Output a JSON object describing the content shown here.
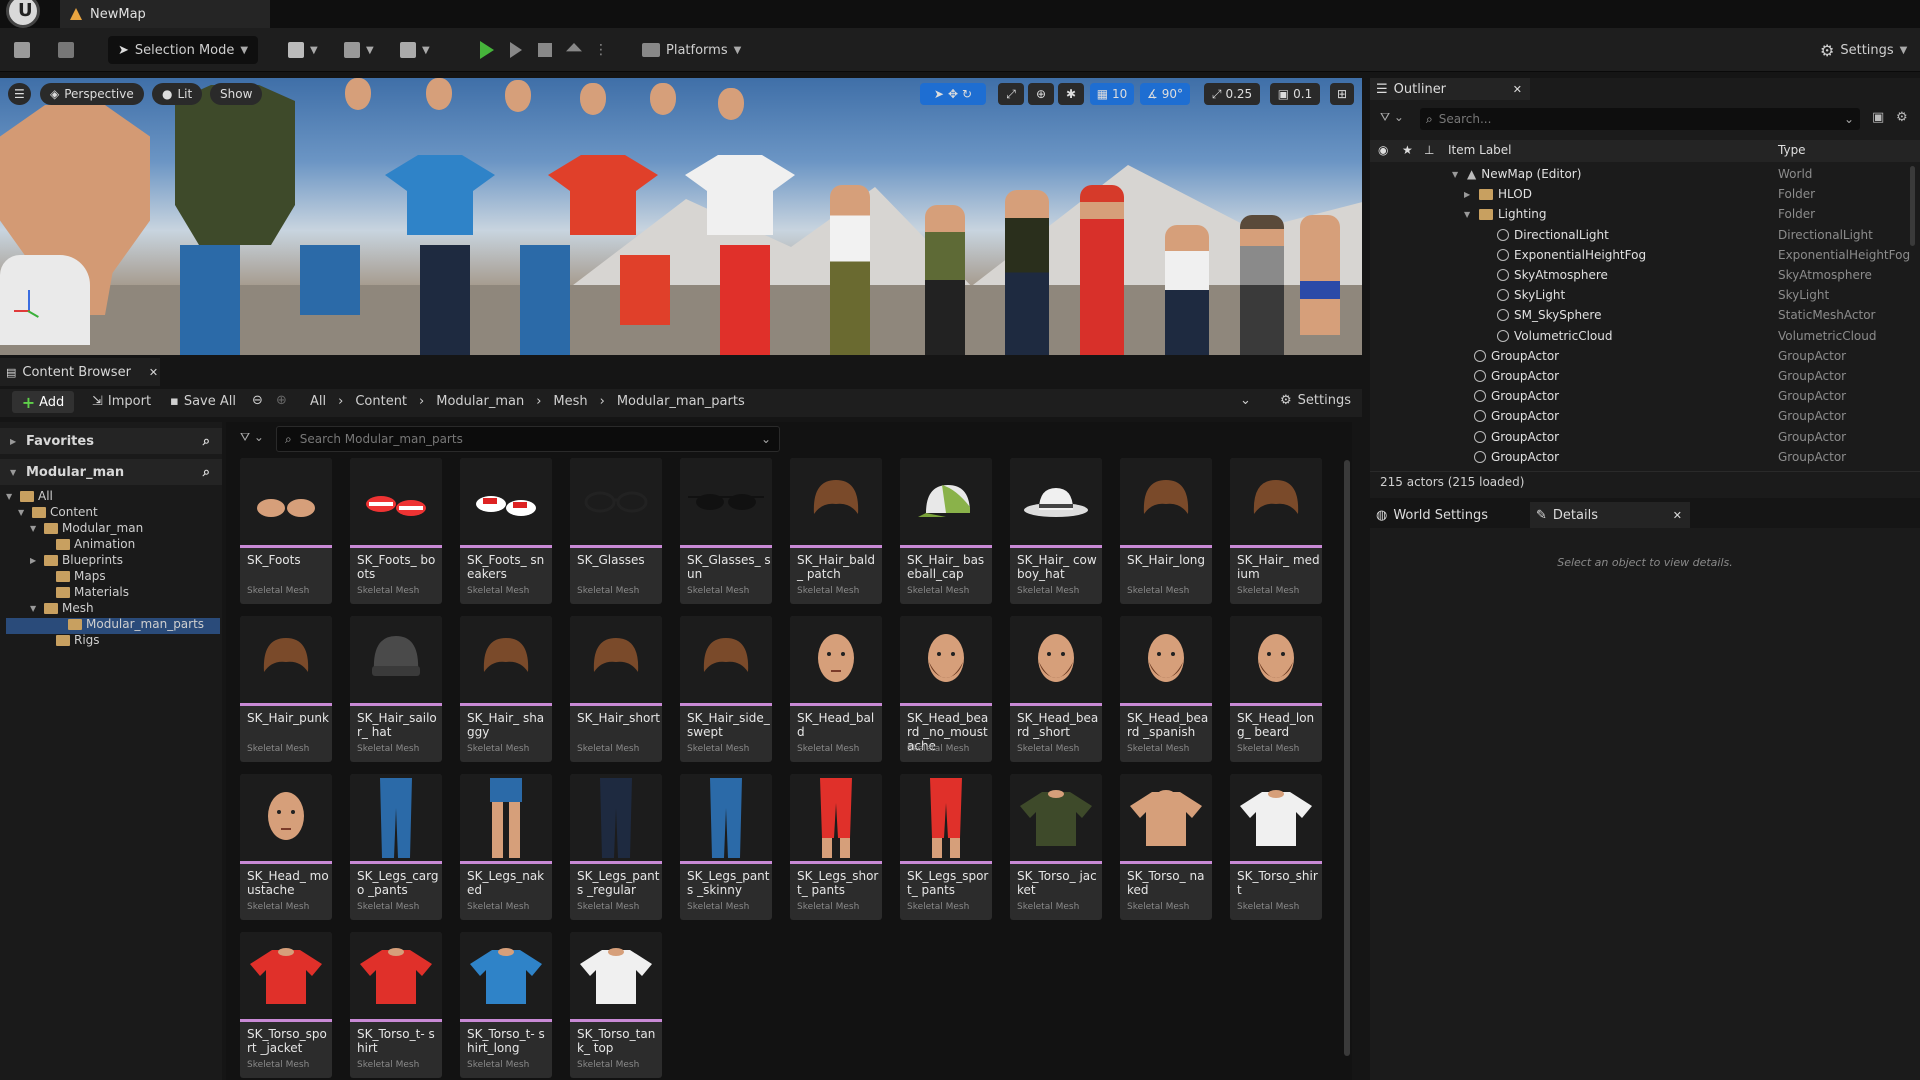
{
  "window": {
    "tab_title": "NewMap"
  },
  "toolbar": {
    "selection_mode": "Selection Mode",
    "platforms": "Platforms",
    "settings": "Settings"
  },
  "viewport": {
    "perspective": "Perspective",
    "lit": "Lit",
    "show": "Show",
    "grid_value": "10",
    "angle_value": "90°",
    "scale_value": "0.25",
    "camera_speed": "0.1"
  },
  "content_browser": {
    "tab_title": "Content Browser",
    "add": "Add",
    "import": "Import",
    "save_all": "Save All",
    "breadcrumb": [
      "All",
      "Content",
      "Modular_man",
      "Mesh",
      "Modular_man_parts"
    ],
    "settings": "Settings",
    "favorites": "Favorites",
    "root_name": "Modular_man",
    "search_placeholder": "Search Modular_man_parts",
    "tree": [
      "All",
      "Content",
      "Modular_man",
      "Animation",
      "Blueprints",
      "Maps",
      "Materials",
      "Mesh",
      "Modular_man_parts",
      "Rigs"
    ],
    "asset_type": "Skeletal Mesh",
    "assets": [
      {
        "name": "SK_Foots",
        "icon": "feet"
      },
      {
        "name": "SK_Foots_ boots",
        "icon": "boots"
      },
      {
        "name": "SK_Foots_ sneakers",
        "icon": "sneakers"
      },
      {
        "name": "SK_Glasses",
        "icon": "glasses"
      },
      {
        "name": "SK_Glasses_ sun",
        "icon": "sunglasses"
      },
      {
        "name": "SK_Hair_bald_ patch",
        "icon": "hair"
      },
      {
        "name": "SK_Hair_ baseball_cap",
        "icon": "cap"
      },
      {
        "name": "SK_Hair_ cowboy_hat",
        "icon": "hat"
      },
      {
        "name": "SK_Hair_long",
        "icon": "hair"
      },
      {
        "name": "SK_Hair_ medium",
        "icon": "hair"
      },
      {
        "name": "SK_Hair_punk",
        "icon": "hair"
      },
      {
        "name": "SK_Hair_sailor_ hat",
        "icon": "beanie"
      },
      {
        "name": "SK_Hair_ shaggy",
        "icon": "hair"
      },
      {
        "name": "SK_Hair_short",
        "icon": "hair"
      },
      {
        "name": "SK_Hair_side_ swept",
        "icon": "hair"
      },
      {
        "name": "SK_Head_bald",
        "icon": "head"
      },
      {
        "name": "SK_Head_beard _no_moustache",
        "icon": "head-beard"
      },
      {
        "name": "SK_Head_beard _short",
        "icon": "head-beard"
      },
      {
        "name": "SK_Head_beard _spanish",
        "icon": "head-beard"
      },
      {
        "name": "SK_Head_long_ beard",
        "icon": "head-beard"
      },
      {
        "name": "SK_Head_ moustache",
        "icon": "head"
      },
      {
        "name": "SK_Legs_cargo _pants",
        "icon": "legs-blue"
      },
      {
        "name": "SK_Legs_naked",
        "icon": "legs-skin"
      },
      {
        "name": "SK_Legs_pants _regular",
        "icon": "legs-navy"
      },
      {
        "name": "SK_Legs_pants _skinny",
        "icon": "legs-blue"
      },
      {
        "name": "SK_Legs_short_ pants",
        "icon": "legs-red"
      },
      {
        "name": "SK_Legs_sport_ pants",
        "icon": "legs-red"
      },
      {
        "name": "SK_Torso_ jacket",
        "icon": "torso-green"
      },
      {
        "name": "SK_Torso_ naked",
        "icon": "torso-skin"
      },
      {
        "name": "SK_Torso_shirt",
        "icon": "torso-white"
      },
      {
        "name": "SK_Torso_sport _jacket",
        "icon": "torso-red"
      },
      {
        "name": "SK_Torso_t- shirt",
        "icon": "torso-red"
      },
      {
        "name": "SK_Torso_t- shirt_long",
        "icon": "torso-blue"
      },
      {
        "name": "SK_Torso_tank_ top",
        "icon": "torso-white"
      }
    ]
  },
  "outliner": {
    "tab_title": "Outliner",
    "search_placeholder": "Search...",
    "col_label": "Item Label",
    "col_type": "Type",
    "rows": [
      {
        "label": "NewMap (Editor)",
        "type": "World",
        "indent": 0
      },
      {
        "label": "HLOD",
        "type": "Folder",
        "indent": 1
      },
      {
        "label": "Lighting",
        "type": "Folder",
        "indent": 1
      },
      {
        "label": "DirectionalLight",
        "type": "DirectionalLight",
        "indent": 2
      },
      {
        "label": "ExponentialHeightFog",
        "type": "ExponentialHeightFog",
        "indent": 2
      },
      {
        "label": "SkyAtmosphere",
        "type": "SkyAtmosphere",
        "indent": 2
      },
      {
        "label": "SkyLight",
        "type": "SkyLight",
        "indent": 2
      },
      {
        "label": "SM_SkySphere",
        "type": "StaticMeshActor",
        "indent": 2
      },
      {
        "label": "VolumetricCloud",
        "type": "VolumetricCloud",
        "indent": 2
      },
      {
        "label": "GroupActor",
        "type": "GroupActor",
        "indent": 1
      },
      {
        "label": "GroupActor",
        "type": "GroupActor",
        "indent": 1
      },
      {
        "label": "GroupActor",
        "type": "GroupActor",
        "indent": 1
      },
      {
        "label": "GroupActor",
        "type": "GroupActor",
        "indent": 1
      },
      {
        "label": "GroupActor",
        "type": "GroupActor",
        "indent": 1
      },
      {
        "label": "GroupActor",
        "type": "GroupActor",
        "indent": 1
      }
    ],
    "actor_count": "215 actors (215 loaded)"
  },
  "details": {
    "world_settings": "World Settings",
    "tab_title": "Details",
    "empty_message": "Select an object to view details."
  },
  "colors": {
    "accent": "#1e6ed2",
    "play": "#46b43b",
    "asset_underline": "#c98ad6"
  }
}
